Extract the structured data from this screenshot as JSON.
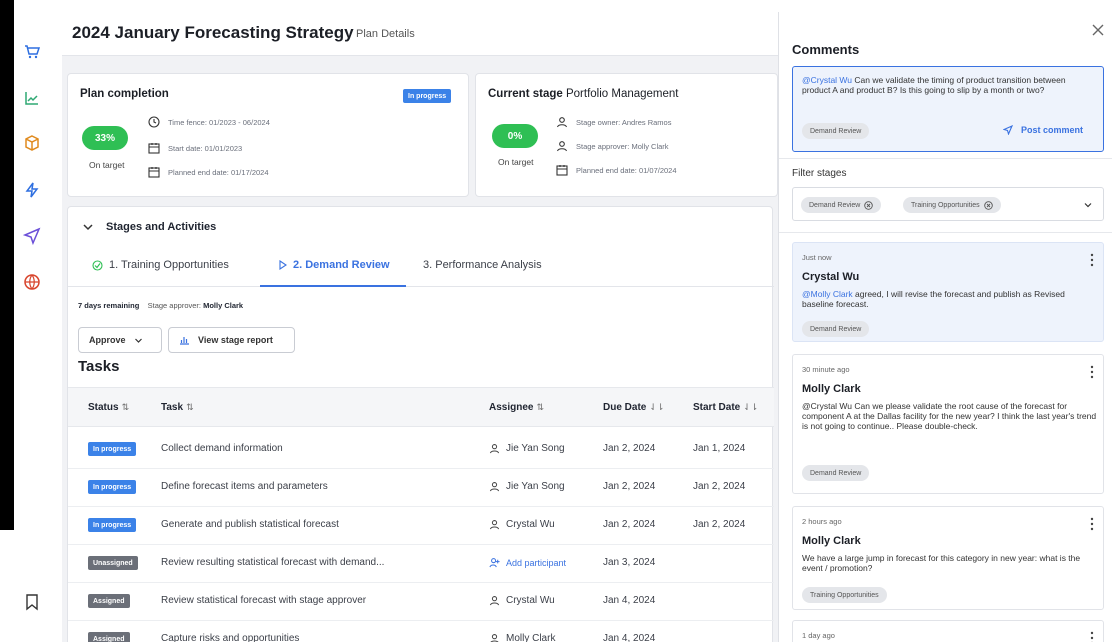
{
  "page": {
    "title": "2024 January Forecasting Strategy",
    "subtitle": "Plan Details"
  },
  "rail": {
    "icons": [
      "cart-icon",
      "chart-icon",
      "box-icon",
      "bolt-icon",
      "send-icon",
      "globe-icon",
      "bookmark-icon"
    ]
  },
  "plan_completion": {
    "title": "Plan completion",
    "status": "In progress",
    "percent": "33%",
    "percent_value": 33,
    "target_label": "On target",
    "time_fence": "Time fence: 01/2023 - 06/2024",
    "start_date": "Start date: 01/01/2023",
    "planned_end": "Planned end date: 01/17/2024"
  },
  "current_stage": {
    "title_bold": "Current stage",
    "title_value": "Portfolio Management",
    "percent": "0%",
    "percent_value": 0,
    "target_label": "On target",
    "owner": "Stage owner: Andres Ramos",
    "approver": "Stage approver: Molly Clark",
    "planned_end": "Planned end date: 01/07/2024"
  },
  "stages": {
    "header": "Stages and Activities",
    "tabs": [
      {
        "label": "1. Training Opportunities",
        "state": "done"
      },
      {
        "label": "2. Demand Review",
        "state": "active"
      },
      {
        "label": "3. Performance Analysis",
        "state": "upcoming"
      }
    ],
    "days_remaining": "7 days remaining",
    "approver_label": "Stage approver:",
    "approver_name": "Molly Clark",
    "approve_button": "Approve",
    "report_button": "View stage report"
  },
  "tasks": {
    "title": "Tasks",
    "columns": {
      "status": "Status",
      "task": "Task",
      "assignee": "Assignee",
      "due": "Due Date",
      "start": "Start Date"
    },
    "rows": [
      {
        "status": "In progress",
        "status_color": "#3b82e8",
        "task": "Collect demand information",
        "assignee": "Jie Yan Song",
        "due": "Jan 2, 2024",
        "start": "Jan 1, 2024"
      },
      {
        "status": "In progress",
        "status_color": "#3b82e8",
        "task": "Define forecast items and parameters",
        "assignee": "Jie Yan Song",
        "due": "Jan 2, 2024",
        "start": "Jan 2, 2024"
      },
      {
        "status": "In progress",
        "status_color": "#3b82e8",
        "task": "Generate and publish statistical forecast",
        "assignee": "Crystal Wu",
        "due": "Jan 2, 2024",
        "start": "Jan 2, 2024"
      },
      {
        "status": "Unassigned",
        "status_color": "#6b6f78",
        "task": "Review resulting statistical forecast with demand...",
        "assignee": "Add participant",
        "due": "Jan 3, 2024",
        "start": ""
      },
      {
        "status": "Assigned",
        "status_color": "#6b6f78",
        "task": "Review statistical forecast with stage approver",
        "assignee": "Crystal Wu",
        "due": "Jan 4, 2024",
        "start": ""
      },
      {
        "status": "Assigned",
        "status_color": "#6b6f78",
        "task": "Capture risks and opportunities",
        "assignee": "Molly Clark",
        "due": "Jan 4, 2024",
        "start": ""
      }
    ]
  },
  "comments": {
    "title": "Comments",
    "compose": {
      "mention": "@Crystal Wu",
      "text": " Can we validate the timing of product transition between product A and product B? Is this going to slip by a month or two?",
      "tag": "Demand Review",
      "post_label": "Post comment"
    },
    "filter_label": "Filter stages",
    "filters": [
      "Demand Review",
      "Training Opportunities"
    ],
    "items": [
      {
        "time": "Just now",
        "author": "Crystal Wu",
        "mention": "@Molly Clark",
        "body": " agreed, I will revise the forecast and publish as Revised baseline forecast.",
        "tag": "Demand Review"
      },
      {
        "time": "30 minute ago",
        "author": "Molly Clark",
        "mention": "",
        "body": "@Crystal Wu Can  we please validate the root cause of the forecast for component A at the Dallas facility for the new year? I think the last year's trend is not going to  continue.. Please double-check.",
        "tag": "Demand Review"
      },
      {
        "time": "2 hours ago",
        "author": "Molly Clark",
        "mention": "",
        "body": "We have a large jump in forecast for this category in new year: what is the event / promotion?",
        "tag": "Training Opportunities"
      },
      {
        "time": "1 day ago",
        "author": "",
        "mention": "",
        "body": "",
        "tag": ""
      }
    ]
  },
  "colors": {
    "accent": "#3a72e0",
    "success": "#2fbf54",
    "rail_icon": "#2e6fe0",
    "rail_icon_alt": "#e08a1e"
  }
}
